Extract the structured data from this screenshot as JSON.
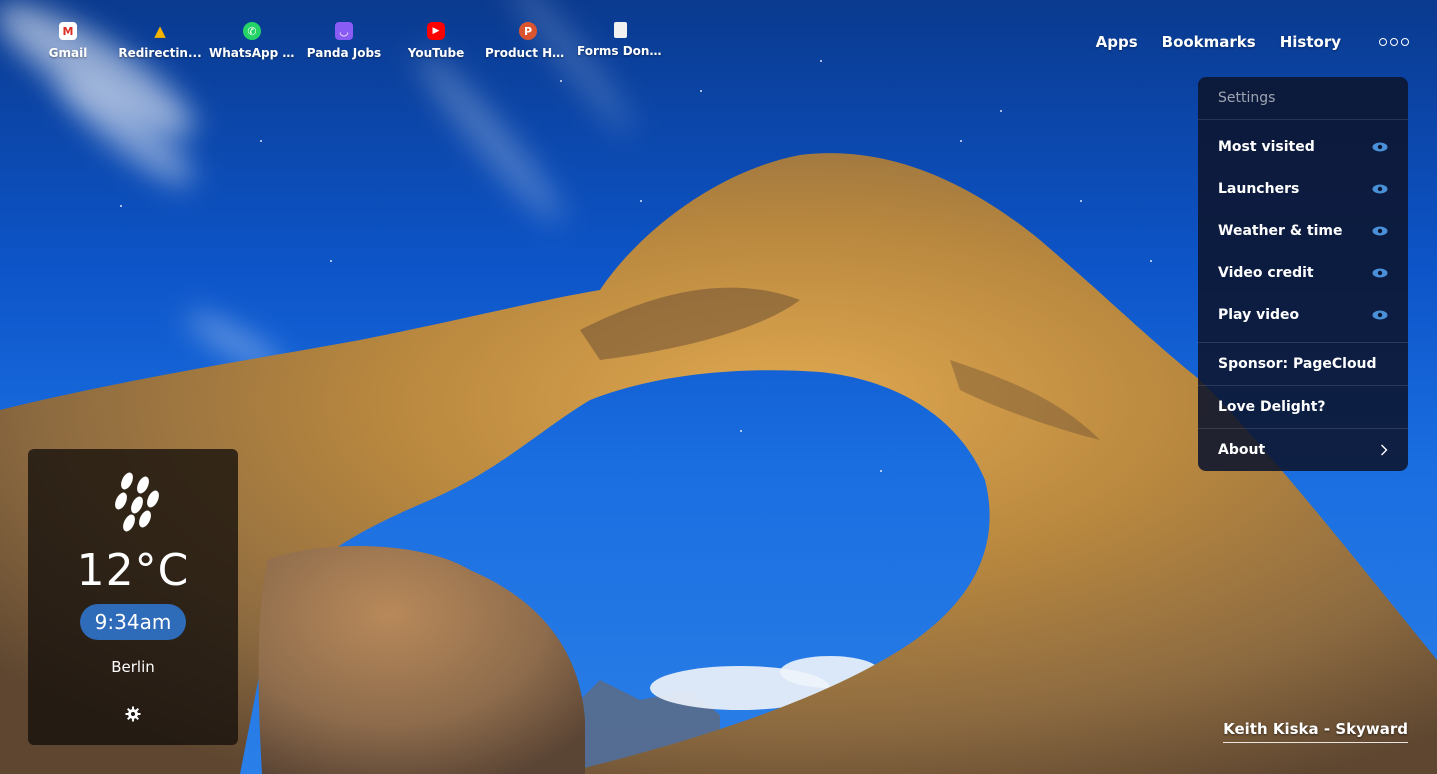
{
  "launchers": [
    {
      "label": "Gmail",
      "icon": "gmail-icon",
      "color": "#d93025",
      "glyph": "M"
    },
    {
      "label": "Redirectin...",
      "icon": "google-drive-icon",
      "color": "#1fa463",
      "glyph": "▲"
    },
    {
      "label": "WhatsApp ...",
      "icon": "whatsapp-icon",
      "color": "#25d366",
      "glyph": "✆"
    },
    {
      "label": "Panda Jobs",
      "icon": "panda-jobs-icon",
      "color": "#8a5cf6",
      "glyph": "◡"
    },
    {
      "label": "YouTube",
      "icon": "youtube-icon",
      "color": "#ff0000",
      "glyph": "▶"
    },
    {
      "label": "Product Hu...",
      "icon": "product-hunt-icon",
      "color": "#da552f",
      "glyph": "P"
    },
    {
      "label": "Forms Don...",
      "icon": "document-icon",
      "color": "#e8e8e8",
      "glyph": ""
    }
  ],
  "nav": {
    "apps": "Apps",
    "bookmarks": "Bookmarks",
    "history": "History",
    "more_icon": "more-circles-icon"
  },
  "settings": {
    "header": "Settings",
    "toggles": [
      {
        "label": "Most visited",
        "icon": "eye-icon"
      },
      {
        "label": "Launchers",
        "icon": "eye-icon"
      },
      {
        "label": "Weather & time",
        "icon": "eye-icon"
      },
      {
        "label": "Video credit",
        "icon": "eye-icon"
      },
      {
        "label": "Play video",
        "icon": "eye-icon"
      }
    ],
    "sponsor": "Sponsor: PageCloud",
    "love": "Love Delight?",
    "about": "About",
    "accent": "#4a90d9"
  },
  "weather": {
    "icon": "rain-icon",
    "temperature": "12°C",
    "time": "9:34am",
    "city": "Berlin",
    "settings_icon": "gear-icon"
  },
  "credit": "Keith Kiska - Skyward"
}
